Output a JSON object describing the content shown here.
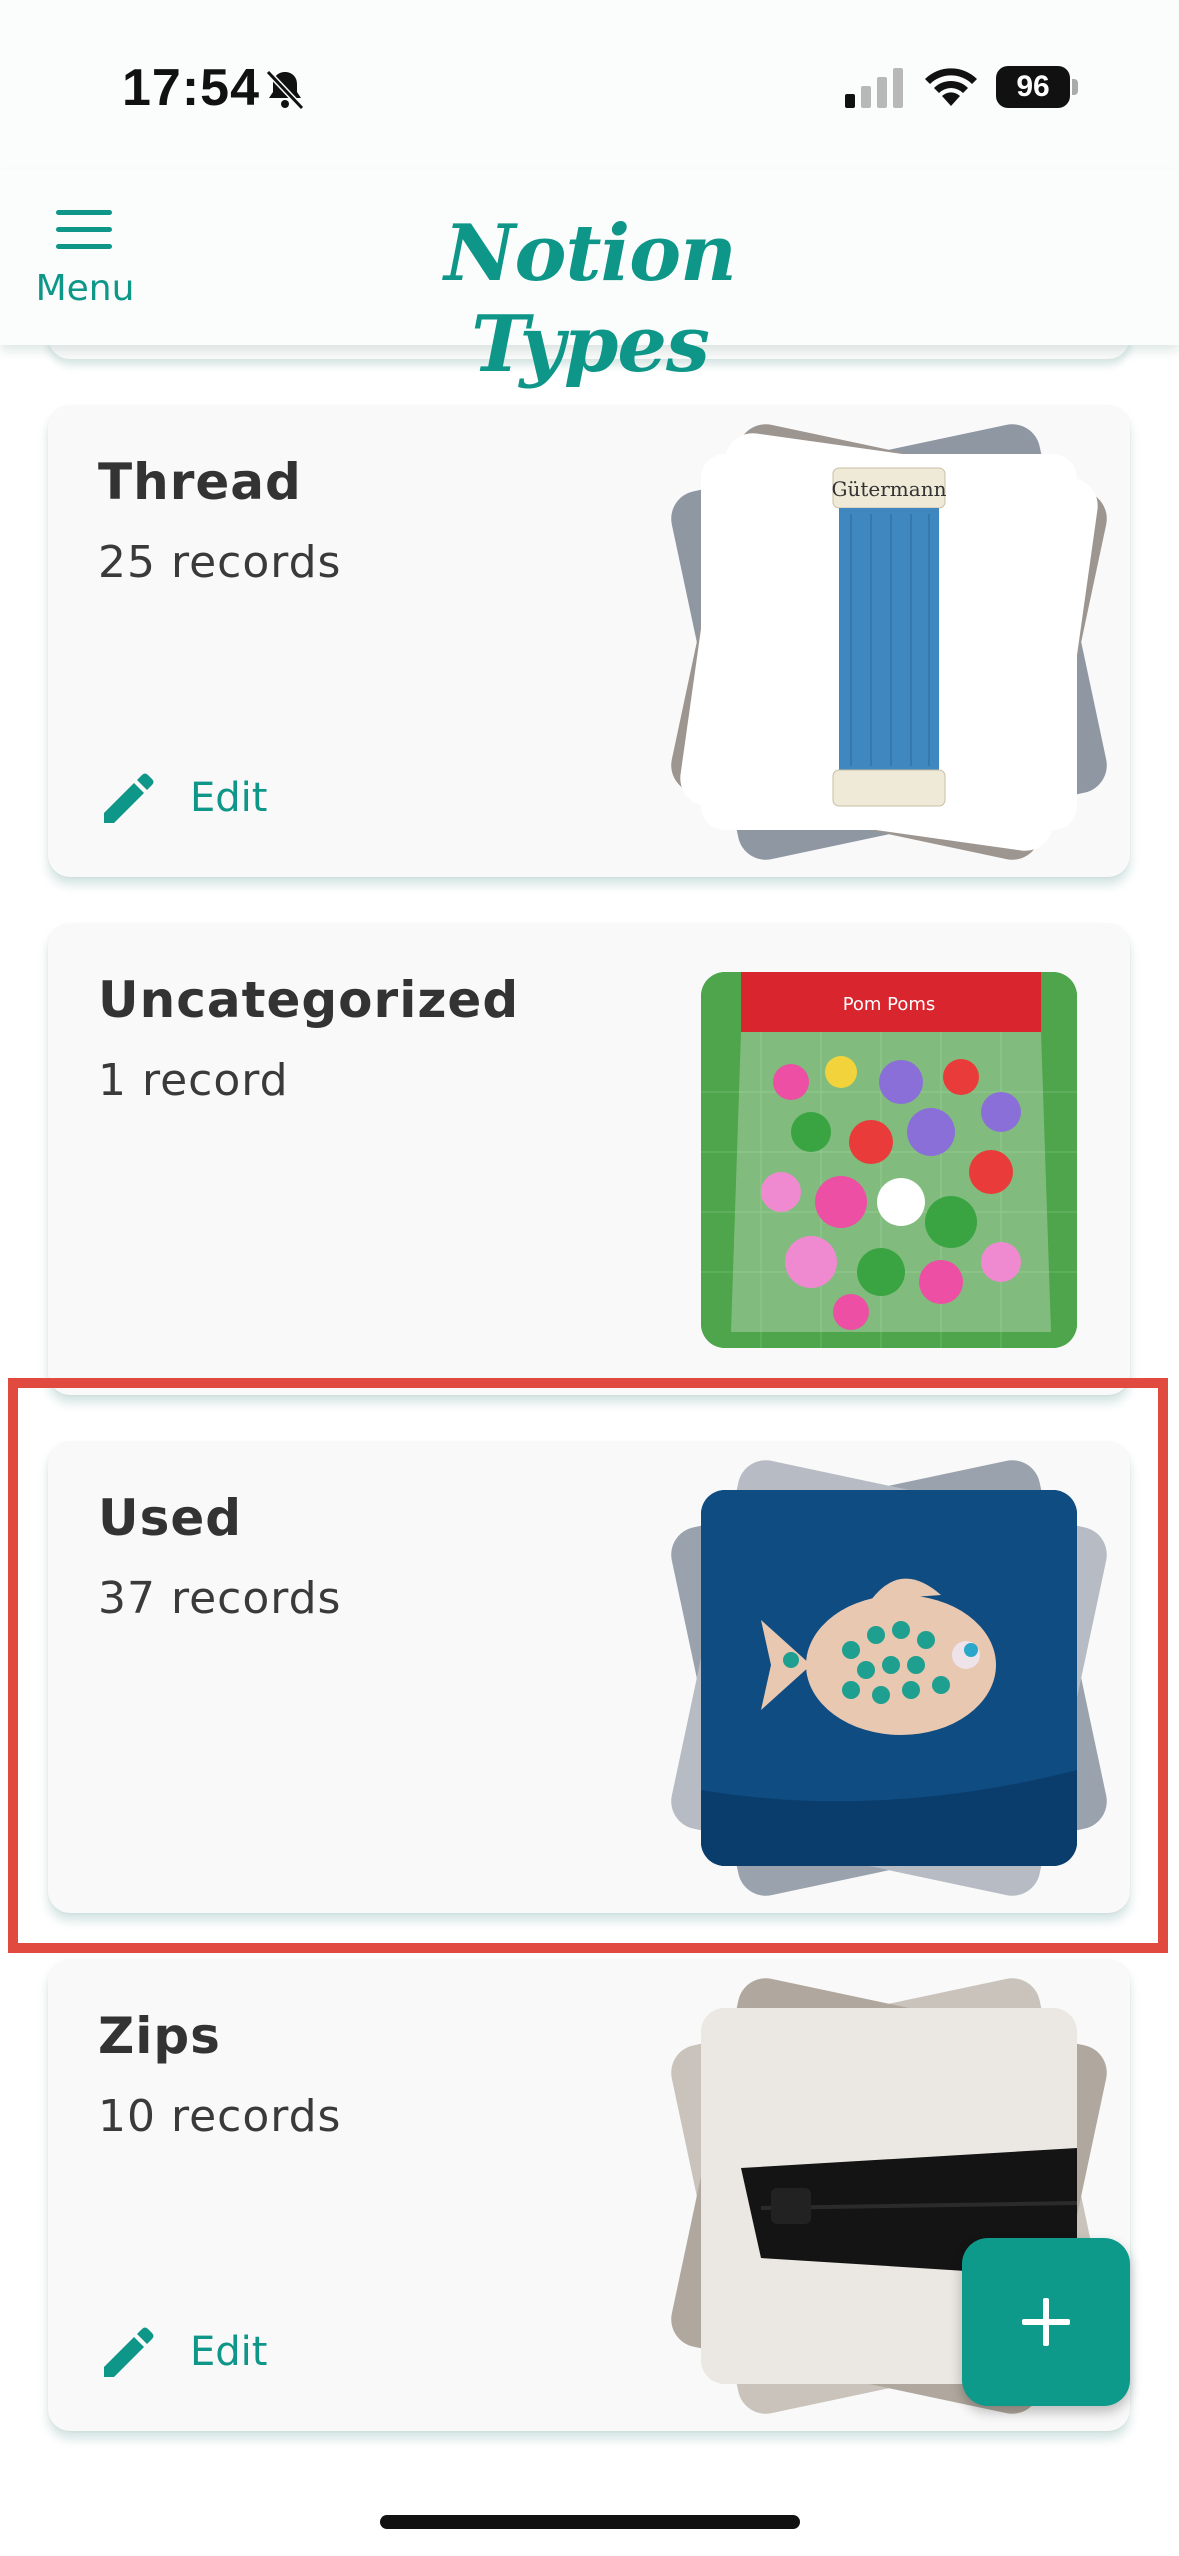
{
  "status_bar": {
    "time": "17:54",
    "battery": "96",
    "icons": [
      "bell-slash-icon",
      "cellular-signal-icon",
      "wifi-icon",
      "battery-icon"
    ]
  },
  "app_bar": {
    "menu_label": "Menu",
    "title": "Notion Types",
    "accent_color": "#0e9688"
  },
  "cards": [
    {
      "title": "Thread",
      "count": "25 records",
      "edit_label": "Edit",
      "image": "blue-thread-spool"
    },
    {
      "title": "Uncategorized",
      "count": "1 record",
      "edit_label": "",
      "image": "pom-poms-pack"
    },
    {
      "title": "Used",
      "count": "37 records",
      "edit_label": "",
      "image": "sequin-fish-applique"
    },
    {
      "title": "Zips",
      "count": "10 records",
      "edit_label": "Edit",
      "image": "black-zip"
    }
  ],
  "fab": {
    "icon": "plus-icon"
  },
  "highlight_color": "#e04a3f"
}
